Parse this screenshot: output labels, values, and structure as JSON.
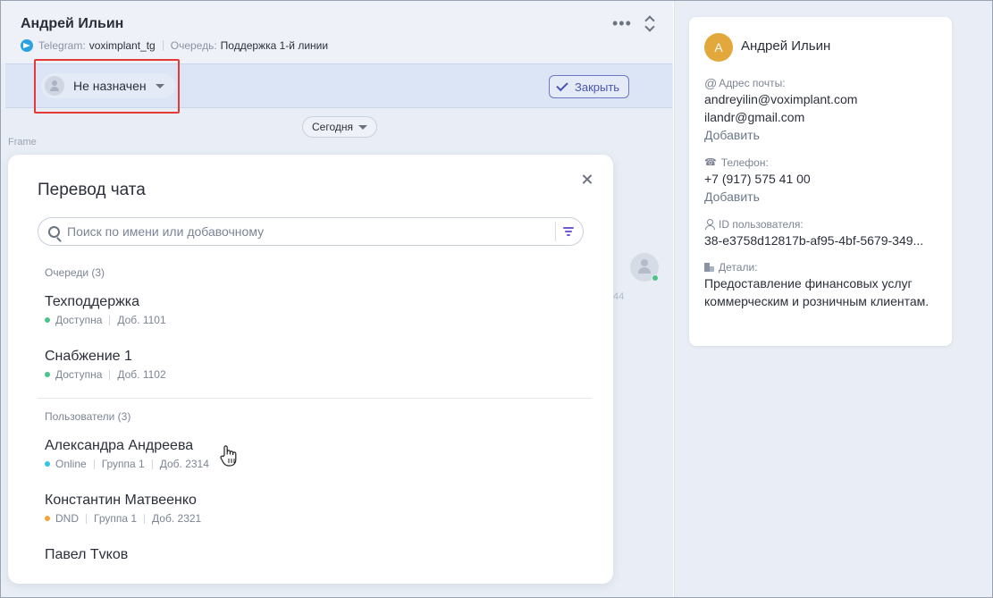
{
  "chat": {
    "contact_name": "Андрей Ильин",
    "channel_label": "Telegram:",
    "channel_value": "voximplant_tg",
    "queue_label": "Очередь:",
    "queue_value": "Поддержка 1-й линии",
    "more_glyph": "•••",
    "assignee_label": "Не назначен",
    "close_label": "Закрыть",
    "date_label": "Сегодня",
    "frame_label": "Frame",
    "bg_time_fragment": "44"
  },
  "modal": {
    "title": "Перевод чата",
    "search_placeholder": "Поиск по имени или добавочному",
    "queues_header": "Очереди (3)",
    "queues": [
      {
        "name": "Техподдержка",
        "status": "Доступна",
        "status_color": "#4cc38a",
        "ext": "Доб. 1101"
      },
      {
        "name": "Снабжение 1",
        "status": "Доступна",
        "status_color": "#4cc38a",
        "ext": "Доб. 1102"
      }
    ],
    "users_header": "Пользователи (3)",
    "users": [
      {
        "name": "Александра Андреева",
        "status": "Online",
        "status_color": "#35c4e8",
        "group": "Группа 1",
        "ext": "Доб. 2314"
      },
      {
        "name": "Константин Матвеенко",
        "status": "DND",
        "status_color": "#f2a33a",
        "group": "Группа 1",
        "ext": "Доб. 2321"
      },
      {
        "name": "Павел Тvков"
      }
    ]
  },
  "profile": {
    "avatar_letter": "А",
    "avatar_color": "#e3a83c",
    "name": "Андрей Ильин",
    "email_label": "Адрес почты:",
    "emails": [
      "andreyilin@voximplant.com",
      "ilandr@gmail.com"
    ],
    "add_label": "Добавить",
    "phone_label": "Телефон:",
    "phone": "+7 (917) 575 41 00",
    "user_id_label": "ID пользователя:",
    "user_id": "38-e3758d12817b-af95-4bf-5679-349...",
    "details_label": "Детали:",
    "details": "Предоставление финансовых услуг коммерческим и розничным клиентам."
  }
}
